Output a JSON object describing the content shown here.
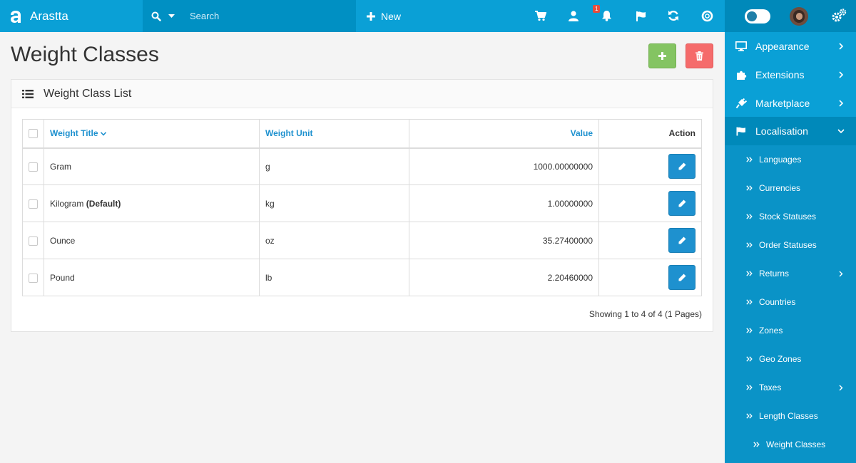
{
  "brand": {
    "name": "Arastta"
  },
  "search": {
    "placeholder": "Search"
  },
  "topbar": {
    "new_label": "New",
    "notification_count": "1"
  },
  "page": {
    "title": "Weight Classes"
  },
  "panel": {
    "title": "Weight Class List"
  },
  "table": {
    "headers": {
      "title": "Weight Title",
      "unit": "Weight Unit",
      "value": "Value",
      "action": "Action"
    },
    "rows": [
      {
        "title": "Gram",
        "default_label": "",
        "unit": "g",
        "value": "1000.00000000"
      },
      {
        "title": "Kilogram",
        "default_label": "(Default)",
        "unit": "kg",
        "value": "1.00000000"
      },
      {
        "title": "Ounce",
        "default_label": "",
        "unit": "oz",
        "value": "35.27400000"
      },
      {
        "title": "Pound",
        "default_label": "",
        "unit": "lb",
        "value": "2.20460000"
      }
    ]
  },
  "pagination": {
    "text": "Showing 1 to 4 of 4 (1 Pages)"
  },
  "sidebar": {
    "items": [
      {
        "label": "Appearance",
        "icon": "monitor-icon"
      },
      {
        "label": "Extensions",
        "icon": "puzzle-icon"
      },
      {
        "label": "Marketplace",
        "icon": "plug-icon"
      },
      {
        "label": "Localisation",
        "icon": "flag-icon"
      }
    ],
    "subitems": [
      {
        "label": "Languages"
      },
      {
        "label": "Currencies"
      },
      {
        "label": "Stock Statuses"
      },
      {
        "label": "Order Statuses"
      },
      {
        "label": "Returns"
      },
      {
        "label": "Countries"
      },
      {
        "label": "Zones"
      },
      {
        "label": "Geo Zones"
      },
      {
        "label": "Taxes"
      },
      {
        "label": "Length Classes"
      },
      {
        "label": "Weight Classes"
      }
    ]
  },
  "colors": {
    "topbar": "#0aa0d6",
    "sidebar_active": "#0089ba",
    "add_button": "#84c462",
    "delete_button": "#f56b6b",
    "link": "#1e91cf"
  }
}
